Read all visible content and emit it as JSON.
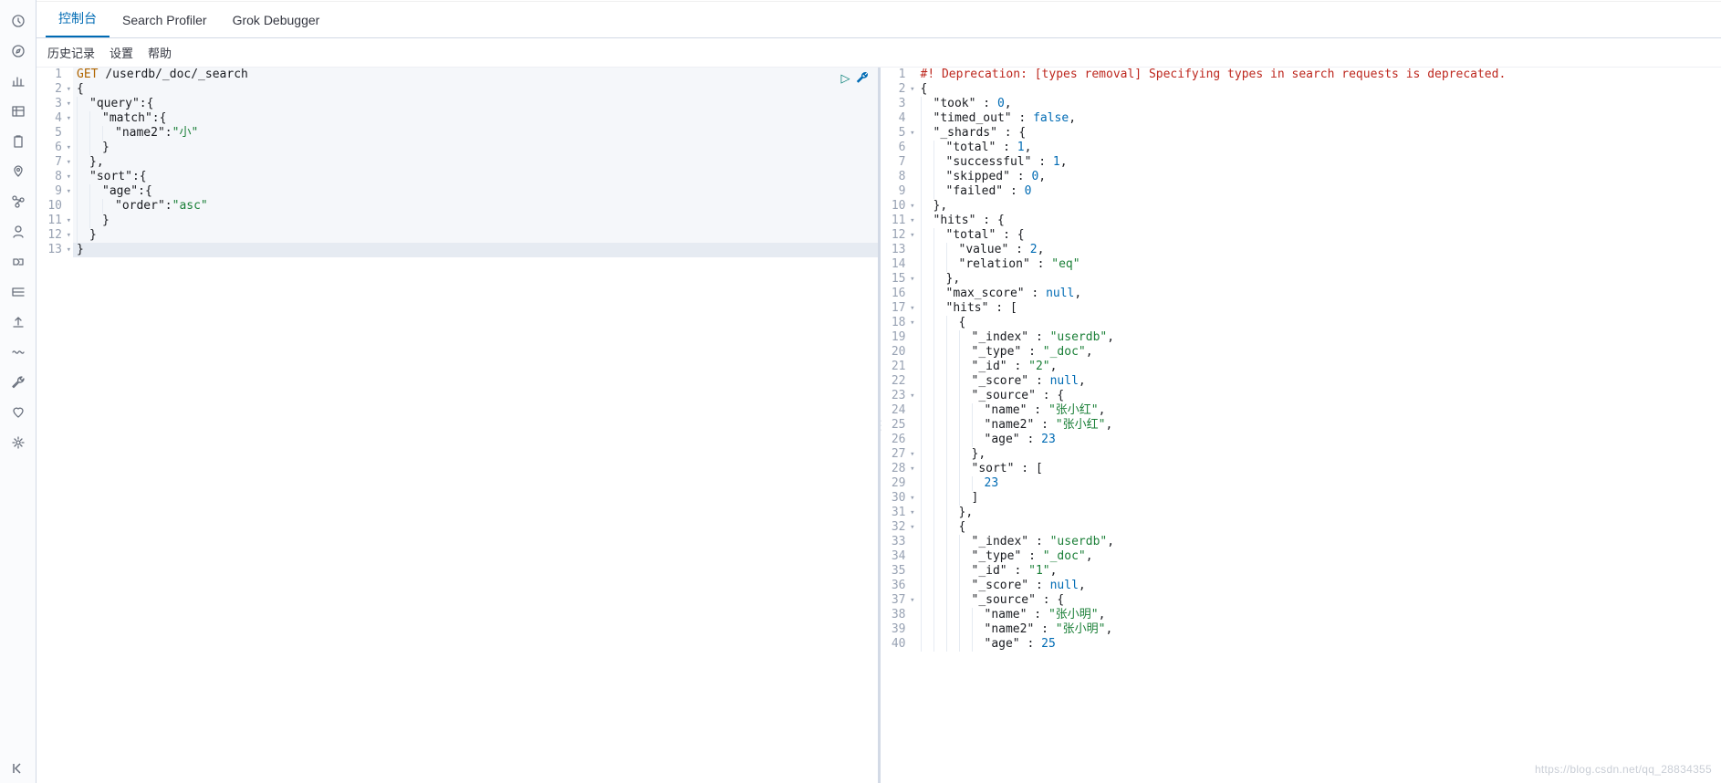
{
  "tabs": {
    "console": "控制台",
    "profiler": "Search Profiler",
    "grok": "Grok Debugger"
  },
  "sublinks": {
    "history": "历史记录",
    "settings": "设置",
    "help": "帮助"
  },
  "sidebar_icons": [
    "clock-icon",
    "compass-icon",
    "bar-chart-icon",
    "table-icon",
    "clipboard-icon",
    "pin-icon",
    "graph-icon",
    "user-icon",
    "pipeline-icon",
    "indent-icon",
    "upload-icon",
    "wave-icon",
    "wrench-icon",
    "heart-icon",
    "gear-icon"
  ],
  "collapse_icon": "collapse-icon",
  "request": {
    "method": "GET",
    "path": "/userdb/_doc/_search",
    "lines": [
      {
        "n": 1,
        "fold": "",
        "tokens": [
          [
            "method",
            "GET"
          ],
          [
            "plain",
            " "
          ],
          [
            "path",
            "/userdb/_doc/_search"
          ]
        ]
      },
      {
        "n": 2,
        "fold": "▾",
        "tokens": [
          [
            "punc",
            "{"
          ]
        ]
      },
      {
        "n": 3,
        "fold": "▾",
        "tokens": [
          [
            "indent",
            1
          ],
          [
            "key",
            "\"query\""
          ],
          [
            "punc",
            ":{"
          ]
        ]
      },
      {
        "n": 4,
        "fold": "▾",
        "tokens": [
          [
            "indent",
            2
          ],
          [
            "key",
            "\"match\""
          ],
          [
            "punc",
            ":{"
          ]
        ]
      },
      {
        "n": 5,
        "fold": "",
        "tokens": [
          [
            "indent",
            3
          ],
          [
            "key",
            "\"name2\""
          ],
          [
            "punc",
            ":"
          ],
          [
            "strv",
            "\"小\""
          ]
        ]
      },
      {
        "n": 6,
        "fold": "▾",
        "tokens": [
          [
            "indent",
            2
          ],
          [
            "punc",
            "}"
          ]
        ]
      },
      {
        "n": 7,
        "fold": "▾",
        "tokens": [
          [
            "indent",
            1
          ],
          [
            "punc",
            "},"
          ]
        ]
      },
      {
        "n": 8,
        "fold": "▾",
        "tokens": [
          [
            "indent",
            1
          ],
          [
            "key",
            "\"sort\""
          ],
          [
            "punc",
            ":{"
          ]
        ]
      },
      {
        "n": 9,
        "fold": "▾",
        "tokens": [
          [
            "indent",
            2
          ],
          [
            "key",
            "\"age\""
          ],
          [
            "punc",
            ":{"
          ]
        ]
      },
      {
        "n": 10,
        "fold": "",
        "tokens": [
          [
            "indent",
            3
          ],
          [
            "key",
            "\"order\""
          ],
          [
            "punc",
            ":"
          ],
          [
            "strv",
            "\"asc\""
          ]
        ]
      },
      {
        "n": 11,
        "fold": "▾",
        "tokens": [
          [
            "indent",
            2
          ],
          [
            "punc",
            "}"
          ]
        ]
      },
      {
        "n": 12,
        "fold": "▾",
        "tokens": [
          [
            "indent",
            1
          ],
          [
            "punc",
            "}"
          ]
        ]
      },
      {
        "n": 13,
        "fold": "▾",
        "tokens": [
          [
            "punc",
            "}"
          ]
        ]
      }
    ]
  },
  "response": {
    "lines": [
      {
        "n": 1,
        "fold": "",
        "tokens": [
          [
            "dep",
            "#! Deprecation: [types removal] Specifying types in search requests is deprecated."
          ]
        ]
      },
      {
        "n": 2,
        "fold": "▾",
        "tokens": [
          [
            "punc",
            "{"
          ]
        ]
      },
      {
        "n": 3,
        "fold": "",
        "tokens": [
          [
            "indent",
            1
          ],
          [
            "key",
            "\"took\""
          ],
          [
            "punc",
            " : "
          ],
          [
            "num",
            "0"
          ],
          [
            "punc",
            ","
          ]
        ]
      },
      {
        "n": 4,
        "fold": "",
        "tokens": [
          [
            "indent",
            1
          ],
          [
            "key",
            "\"timed_out\""
          ],
          [
            "punc",
            " : "
          ],
          [
            "bool",
            "false"
          ],
          [
            "punc",
            ","
          ]
        ]
      },
      {
        "n": 5,
        "fold": "▾",
        "tokens": [
          [
            "indent",
            1
          ],
          [
            "key",
            "\"_shards\""
          ],
          [
            "punc",
            " : {"
          ]
        ]
      },
      {
        "n": 6,
        "fold": "",
        "tokens": [
          [
            "indent",
            2
          ],
          [
            "key",
            "\"total\""
          ],
          [
            "punc",
            " : "
          ],
          [
            "num",
            "1"
          ],
          [
            "punc",
            ","
          ]
        ]
      },
      {
        "n": 7,
        "fold": "",
        "tokens": [
          [
            "indent",
            2
          ],
          [
            "key",
            "\"successful\""
          ],
          [
            "punc",
            " : "
          ],
          [
            "num",
            "1"
          ],
          [
            "punc",
            ","
          ]
        ]
      },
      {
        "n": 8,
        "fold": "",
        "tokens": [
          [
            "indent",
            2
          ],
          [
            "key",
            "\"skipped\""
          ],
          [
            "punc",
            " : "
          ],
          [
            "num",
            "0"
          ],
          [
            "punc",
            ","
          ]
        ]
      },
      {
        "n": 9,
        "fold": "",
        "tokens": [
          [
            "indent",
            2
          ],
          [
            "key",
            "\"failed\""
          ],
          [
            "punc",
            " : "
          ],
          [
            "num",
            "0"
          ]
        ]
      },
      {
        "n": 10,
        "fold": "▾",
        "tokens": [
          [
            "indent",
            1
          ],
          [
            "punc",
            "},"
          ]
        ]
      },
      {
        "n": 11,
        "fold": "▾",
        "tokens": [
          [
            "indent",
            1
          ],
          [
            "key",
            "\"hits\""
          ],
          [
            "punc",
            " : {"
          ]
        ]
      },
      {
        "n": 12,
        "fold": "▾",
        "tokens": [
          [
            "indent",
            2
          ],
          [
            "key",
            "\"total\""
          ],
          [
            "punc",
            " : {"
          ]
        ]
      },
      {
        "n": 13,
        "fold": "",
        "tokens": [
          [
            "indent",
            3
          ],
          [
            "key",
            "\"value\""
          ],
          [
            "punc",
            " : "
          ],
          [
            "num",
            "2"
          ],
          [
            "punc",
            ","
          ]
        ]
      },
      {
        "n": 14,
        "fold": "",
        "tokens": [
          [
            "indent",
            3
          ],
          [
            "key",
            "\"relation\""
          ],
          [
            "punc",
            " : "
          ],
          [
            "strv",
            "\"eq\""
          ]
        ]
      },
      {
        "n": 15,
        "fold": "▾",
        "tokens": [
          [
            "indent",
            2
          ],
          [
            "punc",
            "},"
          ]
        ]
      },
      {
        "n": 16,
        "fold": "",
        "tokens": [
          [
            "indent",
            2
          ],
          [
            "key",
            "\"max_score\""
          ],
          [
            "punc",
            " : "
          ],
          [
            "null",
            "null"
          ],
          [
            "punc",
            ","
          ]
        ]
      },
      {
        "n": 17,
        "fold": "▾",
        "tokens": [
          [
            "indent",
            2
          ],
          [
            "key",
            "\"hits\""
          ],
          [
            "punc",
            " : ["
          ]
        ]
      },
      {
        "n": 18,
        "fold": "▾",
        "tokens": [
          [
            "indent",
            3
          ],
          [
            "punc",
            "{"
          ]
        ]
      },
      {
        "n": 19,
        "fold": "",
        "tokens": [
          [
            "indent",
            4
          ],
          [
            "key",
            "\"_index\""
          ],
          [
            "punc",
            " : "
          ],
          [
            "strv",
            "\"userdb\""
          ],
          [
            "punc",
            ","
          ]
        ]
      },
      {
        "n": 20,
        "fold": "",
        "tokens": [
          [
            "indent",
            4
          ],
          [
            "key",
            "\"_type\""
          ],
          [
            "punc",
            " : "
          ],
          [
            "strv",
            "\"_doc\""
          ],
          [
            "punc",
            ","
          ]
        ]
      },
      {
        "n": 21,
        "fold": "",
        "tokens": [
          [
            "indent",
            4
          ],
          [
            "key",
            "\"_id\""
          ],
          [
            "punc",
            " : "
          ],
          [
            "strv",
            "\"2\""
          ],
          [
            "punc",
            ","
          ]
        ]
      },
      {
        "n": 22,
        "fold": "",
        "tokens": [
          [
            "indent",
            4
          ],
          [
            "key",
            "\"_score\""
          ],
          [
            "punc",
            " : "
          ],
          [
            "null",
            "null"
          ],
          [
            "punc",
            ","
          ]
        ]
      },
      {
        "n": 23,
        "fold": "▾",
        "tokens": [
          [
            "indent",
            4
          ],
          [
            "key",
            "\"_source\""
          ],
          [
            "punc",
            " : {"
          ]
        ]
      },
      {
        "n": 24,
        "fold": "",
        "tokens": [
          [
            "indent",
            5
          ],
          [
            "key",
            "\"name\""
          ],
          [
            "punc",
            " : "
          ],
          [
            "strv",
            "\"张小红\""
          ],
          [
            "punc",
            ","
          ]
        ]
      },
      {
        "n": 25,
        "fold": "",
        "tokens": [
          [
            "indent",
            5
          ],
          [
            "key",
            "\"name2\""
          ],
          [
            "punc",
            " : "
          ],
          [
            "strv",
            "\"张小红\""
          ],
          [
            "punc",
            ","
          ]
        ]
      },
      {
        "n": 26,
        "fold": "",
        "tokens": [
          [
            "indent",
            5
          ],
          [
            "key",
            "\"age\""
          ],
          [
            "punc",
            " : "
          ],
          [
            "num",
            "23"
          ]
        ]
      },
      {
        "n": 27,
        "fold": "▾",
        "tokens": [
          [
            "indent",
            4
          ],
          [
            "punc",
            "},"
          ]
        ]
      },
      {
        "n": 28,
        "fold": "▾",
        "tokens": [
          [
            "indent",
            4
          ],
          [
            "key",
            "\"sort\""
          ],
          [
            "punc",
            " : ["
          ]
        ]
      },
      {
        "n": 29,
        "fold": "",
        "tokens": [
          [
            "indent",
            5
          ],
          [
            "num",
            "23"
          ]
        ]
      },
      {
        "n": 30,
        "fold": "▾",
        "tokens": [
          [
            "indent",
            4
          ],
          [
            "punc",
            "]"
          ]
        ]
      },
      {
        "n": 31,
        "fold": "▾",
        "tokens": [
          [
            "indent",
            3
          ],
          [
            "punc",
            "},"
          ]
        ]
      },
      {
        "n": 32,
        "fold": "▾",
        "tokens": [
          [
            "indent",
            3
          ],
          [
            "punc",
            "{"
          ]
        ]
      },
      {
        "n": 33,
        "fold": "",
        "tokens": [
          [
            "indent",
            4
          ],
          [
            "key",
            "\"_index\""
          ],
          [
            "punc",
            " : "
          ],
          [
            "strv",
            "\"userdb\""
          ],
          [
            "punc",
            ","
          ]
        ]
      },
      {
        "n": 34,
        "fold": "",
        "tokens": [
          [
            "indent",
            4
          ],
          [
            "key",
            "\"_type\""
          ],
          [
            "punc",
            " : "
          ],
          [
            "strv",
            "\"_doc\""
          ],
          [
            "punc",
            ","
          ]
        ]
      },
      {
        "n": 35,
        "fold": "",
        "tokens": [
          [
            "indent",
            4
          ],
          [
            "key",
            "\"_id\""
          ],
          [
            "punc",
            " : "
          ],
          [
            "strv",
            "\"1\""
          ],
          [
            "punc",
            ","
          ]
        ]
      },
      {
        "n": 36,
        "fold": "",
        "tokens": [
          [
            "indent",
            4
          ],
          [
            "key",
            "\"_score\""
          ],
          [
            "punc",
            " : "
          ],
          [
            "null",
            "null"
          ],
          [
            "punc",
            ","
          ]
        ]
      },
      {
        "n": 37,
        "fold": "▾",
        "tokens": [
          [
            "indent",
            4
          ],
          [
            "key",
            "\"_source\""
          ],
          [
            "punc",
            " : {"
          ]
        ]
      },
      {
        "n": 38,
        "fold": "",
        "tokens": [
          [
            "indent",
            5
          ],
          [
            "key",
            "\"name\""
          ],
          [
            "punc",
            " : "
          ],
          [
            "strv",
            "\"张小明\""
          ],
          [
            "punc",
            ","
          ]
        ]
      },
      {
        "n": 39,
        "fold": "",
        "tokens": [
          [
            "indent",
            5
          ],
          [
            "key",
            "\"name2\""
          ],
          [
            "punc",
            " : "
          ],
          [
            "strv",
            "\"张小明\""
          ],
          [
            "punc",
            ","
          ]
        ]
      },
      {
        "n": 40,
        "fold": "",
        "tokens": [
          [
            "indent",
            5
          ],
          [
            "key",
            "\"age\""
          ],
          [
            "punc",
            " : "
          ],
          [
            "num",
            "25"
          ]
        ]
      }
    ]
  },
  "watermark": "https://blog.csdn.net/qq_28834355"
}
